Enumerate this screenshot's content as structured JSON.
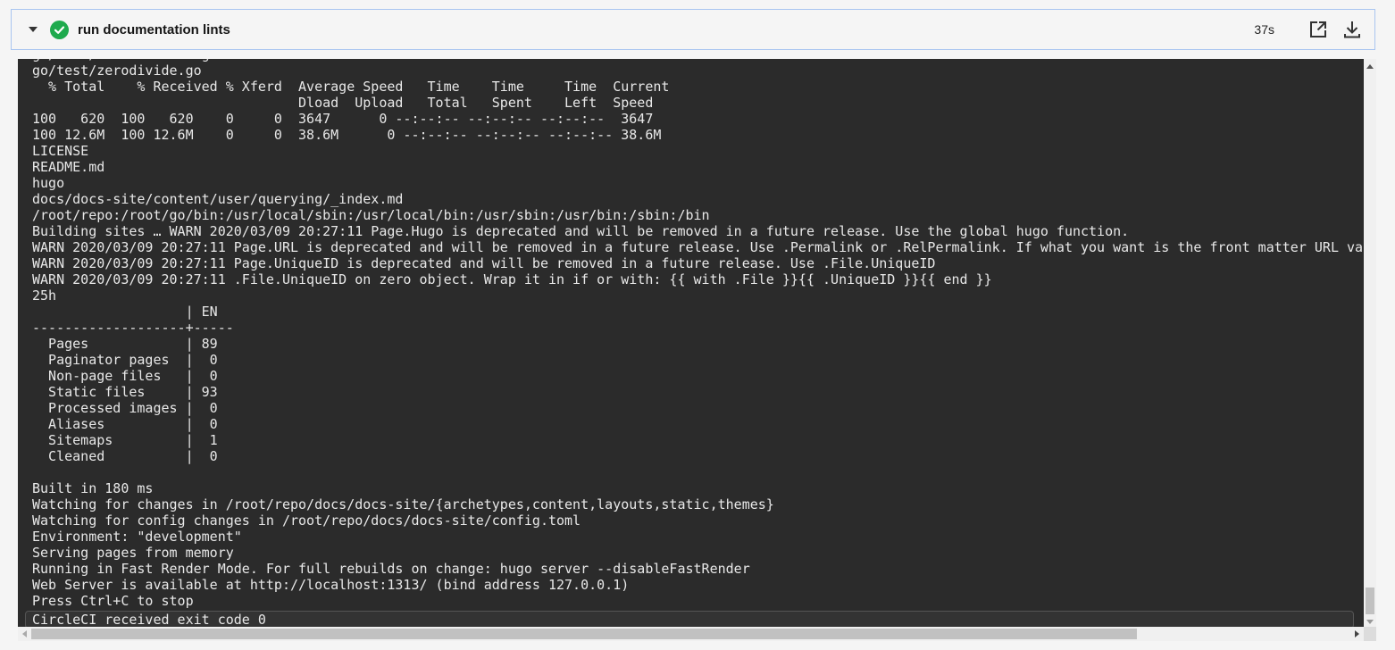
{
  "step": {
    "title": "run documentation lints",
    "status": "success",
    "status_color": "#1eaa4d",
    "duration": "37s",
    "icons": {
      "toggle": "caret-down-icon",
      "status": "check-circle-icon",
      "open_external": "external-link-icon",
      "download": "download-icon"
    }
  },
  "terminal": {
    "lines": [
      "go/test/writebarrier.go",
      "go/test/zerodivide.go",
      "  % Total    % Received % Xferd  Average Speed   Time    Time     Time  Current",
      "                                 Dload  Upload   Total   Spent    Left  Speed",
      "100   620  100   620    0     0  3647      0 --:--:-- --:--:-- --:--:--  3647",
      "100 12.6M  100 12.6M    0     0  38.6M      0 --:--:-- --:--:-- --:--:-- 38.6M",
      "LICENSE",
      "README.md",
      "hugo",
      "docs/docs-site/content/user/querying/_index.md",
      "/root/repo:/root/go/bin:/usr/local/sbin:/usr/local/bin:/usr/sbin:/usr/bin:/sbin:/bin",
      "Building sites … WARN 2020/03/09 20:27:11 Page.Hugo is deprecated and will be removed in a future release. Use the global hugo function.",
      "WARN 2020/03/09 20:27:11 Page.URL is deprecated and will be removed in a future release. Use .Permalink or .RelPermalink. If what you want is the front matter URL value, use .Params.url",
      "WARN 2020/03/09 20:27:11 Page.UniqueID is deprecated and will be removed in a future release. Use .File.UniqueID",
      "WARN 2020/03/09 20:27:11 .File.UniqueID on zero object. Wrap it in if or with: {{ with .File }}{{ .UniqueID }}{{ end }}",
      "25h",
      "                   | EN",
      "-------------------+-----",
      "  Pages            | 89",
      "  Paginator pages  |  0",
      "  Non-page files   |  0",
      "  Static files     | 93",
      "  Processed images |  0",
      "  Aliases          |  0",
      "  Sitemaps         |  1",
      "  Cleaned          |  0",
      "",
      "Built in 180 ms",
      "Watching for changes in /root/repo/docs/docs-site/{archetypes,content,layouts,static,themes}",
      "Watching for config changes in /root/repo/docs/docs-site/config.toml",
      "Environment: \"development\"",
      "Serving pages from memory",
      "Running in Fast Render Mode. For full rebuilds on change: hugo server --disableFastRender",
      "Web Server is available at http://localhost:1313/ (bind address 127.0.0.1)",
      "Press Ctrl+C to stop"
    ],
    "exit_message": "CircleCI received exit code 0",
    "background_color": "#2b2b2b",
    "text_color": "#e8e8e8"
  }
}
